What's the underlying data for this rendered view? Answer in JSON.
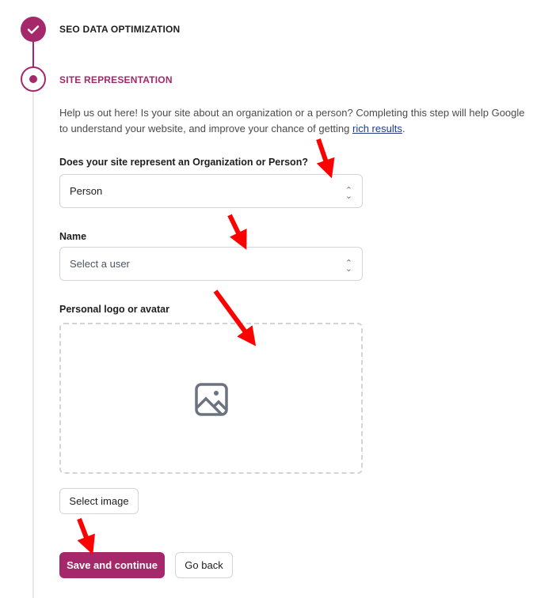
{
  "steps": [
    {
      "title": "SEO DATA OPTIMIZATION",
      "state": "complete",
      "icon": "check-icon"
    },
    {
      "title": "SITE REPRESENTATION",
      "state": "active"
    }
  ],
  "intro": {
    "text": "Help us out here! Is your site about an organization or a person? Completing this step will help Google to understand your website, and improve your chance of getting ",
    "link": "rich results",
    "end": "."
  },
  "represent": {
    "label": "Does your site represent an Organization or Person?",
    "value": "Person"
  },
  "name": {
    "label": "Name",
    "placeholder": "Select a user"
  },
  "logo": {
    "label": "Personal logo or avatar",
    "icon": "image-icon",
    "button": "Select image"
  },
  "actions": {
    "save": "Save and continue",
    "back": "Go back"
  },
  "colors": {
    "accent": "#a4286a",
    "annotation": "#ff0000"
  }
}
